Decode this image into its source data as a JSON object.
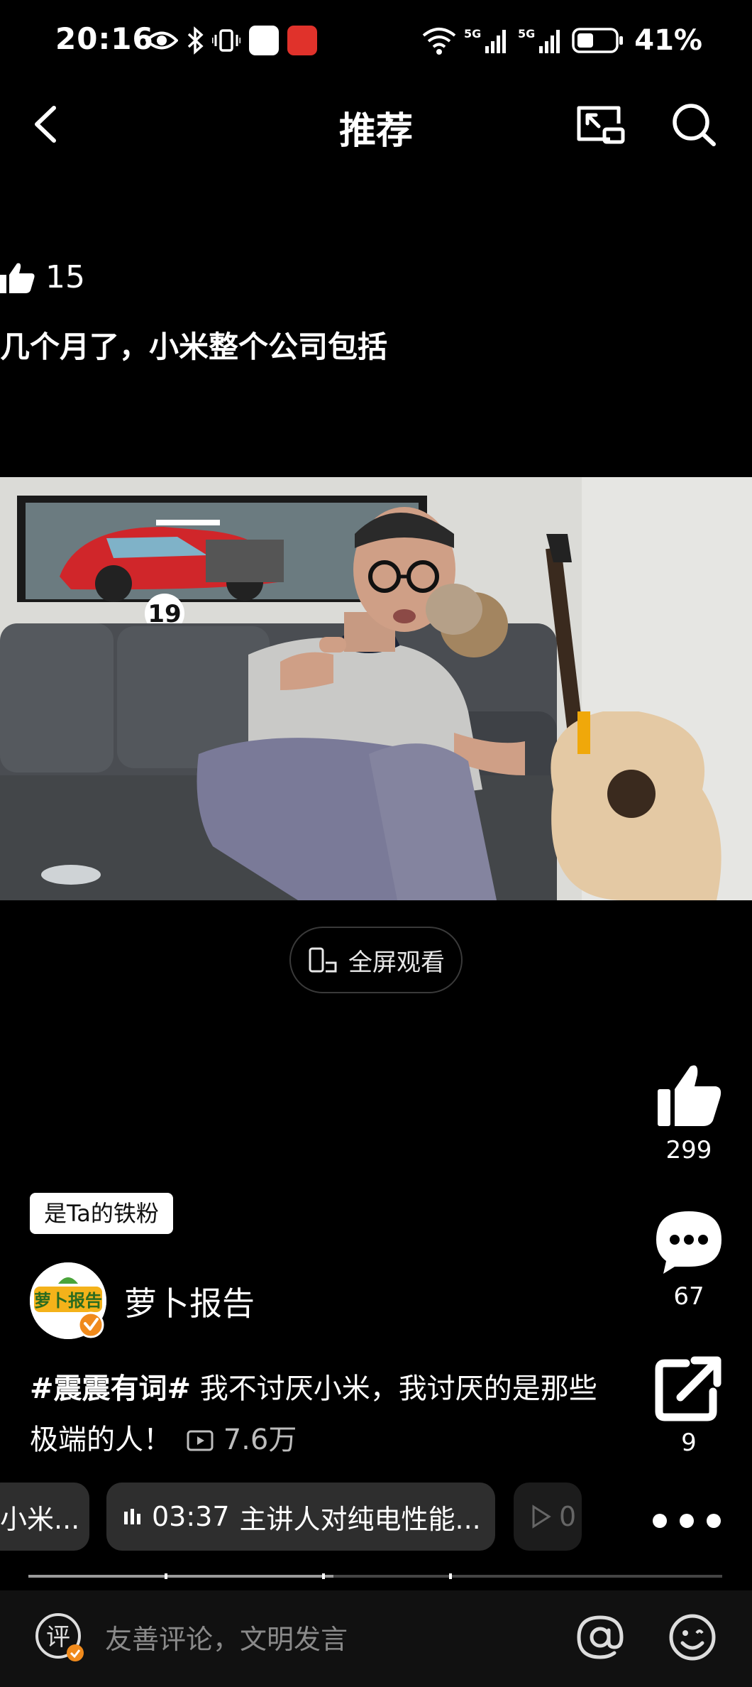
{
  "status_bar": {
    "time": "20:16",
    "network_1": "5G",
    "network_2": "5G",
    "battery": "41%",
    "left_icons": [
      "eye-icon",
      "bluetooth-icon",
      "vibrate-icon",
      "app-icon",
      "app-icon"
    ],
    "right_icons": [
      "wifi-icon",
      "signal-icon",
      "signal-icon",
      "battery-icon"
    ]
  },
  "nav": {
    "title": "推荐",
    "icons": [
      "back-icon",
      "cast-icon",
      "search-icon"
    ]
  },
  "overlay_comment": {
    "likes": "15",
    "text": "几个月了，小米整个公司包括"
  },
  "video": {
    "fullscreen_label": "全屏观看",
    "poster_number": "19"
  },
  "actions": {
    "like_count": "299",
    "comment_count": "67",
    "share_count": "9"
  },
  "fan_badge": "是Ta的铁粉",
  "author": {
    "name": "萝卜报告",
    "avatar_text": "萝卜报告"
  },
  "description": {
    "hashtag": "#震震有词#",
    "text": " 我不讨厌小米，我讨厌的是那些极端的人！",
    "views": "7.6万"
  },
  "chapters": [
    {
      "label": "小米..."
    },
    {
      "time": "03:37",
      "label": "主讲人对纯电性能..."
    },
    {
      "label": "0"
    }
  ],
  "progress": {
    "fraction": 0.44,
    "chapter_marks": [
      0.196,
      0.423,
      0.606
    ]
  },
  "bottom_bar": {
    "comment_icon_char": "评",
    "placeholder": "友善评论，文明发言",
    "icons": [
      "comment-icon",
      "at-icon",
      "emoji-icon"
    ]
  },
  "colors": {
    "background": "#000000",
    "chip": "#2e2e2e",
    "badge_orange": "#f08a1c"
  }
}
